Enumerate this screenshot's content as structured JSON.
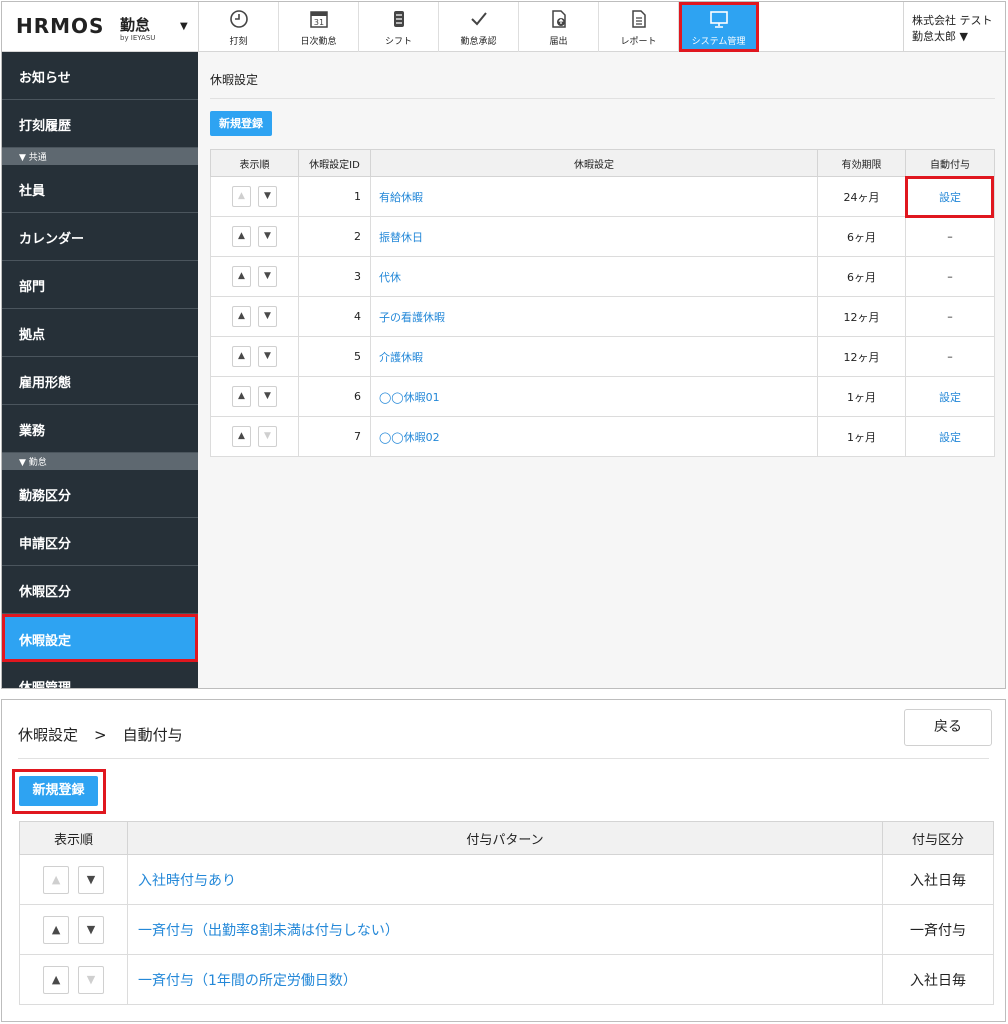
{
  "app": {
    "brand": "HRMOS",
    "brand_kanji": "勤怠",
    "by": "by IEYASU"
  },
  "nav": [
    {
      "label": "打刻",
      "icon": "clock-icon"
    },
    {
      "label": "日次勤怠",
      "icon": "calendar-icon",
      "cal_day": "31"
    },
    {
      "label": "シフト",
      "icon": "shift-icon"
    },
    {
      "label": "勤怠承認",
      "icon": "checkmark-icon"
    },
    {
      "label": "届出",
      "icon": "document-upload-icon"
    },
    {
      "label": "レポート",
      "icon": "report-icon"
    },
    {
      "label": "システム管理",
      "icon": "monitor-icon",
      "active": true
    }
  ],
  "user": {
    "company": "株式会社 テスト",
    "name": "勤怠太郎 ▼"
  },
  "sidebar": {
    "items_top": [
      "お知らせ",
      "打刻履歴"
    ],
    "section_common": "▼ 共通",
    "items_common": [
      "社員",
      "カレンダー",
      "部門",
      "拠点",
      "雇用形態",
      "業務"
    ],
    "section_attendance": "▼ 勤怠",
    "items_attendance": [
      "勤務区分",
      "申請区分",
      "休暇区分"
    ],
    "active_item": "休暇設定",
    "cut_item": "休暇管理"
  },
  "panel1": {
    "title": "休暇設定",
    "new_button": "新規登録",
    "headers": [
      "表示順",
      "休暇設定ID",
      "休暇設定",
      "有効期限",
      "自動付与"
    ],
    "rows": [
      {
        "id": "1",
        "name": "有給休暇",
        "expiry": "24ヶ月",
        "auto": "設定",
        "auto_link": true,
        "up_disabled": true,
        "down_disabled": false
      },
      {
        "id": "2",
        "name": "振替休日",
        "expiry": "6ヶ月",
        "auto": "–",
        "auto_link": false,
        "up_disabled": false,
        "down_disabled": false
      },
      {
        "id": "3",
        "name": "代休",
        "expiry": "6ヶ月",
        "auto": "–",
        "auto_link": false,
        "up_disabled": false,
        "down_disabled": false
      },
      {
        "id": "4",
        "name": "子の看護休暇",
        "expiry": "12ヶ月",
        "auto": "–",
        "auto_link": false,
        "up_disabled": false,
        "down_disabled": false
      },
      {
        "id": "5",
        "name": "介護休暇",
        "expiry": "12ヶ月",
        "auto": "–",
        "auto_link": false,
        "up_disabled": false,
        "down_disabled": false
      },
      {
        "id": "6",
        "name": "◯◯休暇01",
        "expiry": "1ヶ月",
        "auto": "設定",
        "auto_link": true,
        "up_disabled": false,
        "down_disabled": false
      },
      {
        "id": "7",
        "name": "◯◯休暇02",
        "expiry": "1ヶ月",
        "auto": "設定",
        "auto_link": true,
        "up_disabled": false,
        "down_disabled": true
      }
    ]
  },
  "panel2": {
    "breadcrumb": [
      "休暇設定",
      ">",
      "自動付与"
    ],
    "back_button": "戻る",
    "new_button": "新規登録",
    "headers": [
      "表示順",
      "付与パターン",
      "付与区分"
    ],
    "rows": [
      {
        "pattern": "入社時付与あり",
        "type": "入社日毎",
        "up_disabled": true,
        "down_disabled": false
      },
      {
        "pattern": "一斉付与（出勤率8割未満は付与しない）",
        "type": "一斉付与",
        "up_disabled": false,
        "down_disabled": false
      },
      {
        "pattern": "一斉付与（1年間の所定労働日数）",
        "type": "入社日毎",
        "up_disabled": false,
        "down_disabled": true
      }
    ]
  },
  "arrows": {
    "up": "▲",
    "down": "▼"
  },
  "colors": {
    "accent": "#2ea3f2",
    "highlight": "#e0171f",
    "sidebar": "#263038",
    "link": "#2488d8"
  }
}
